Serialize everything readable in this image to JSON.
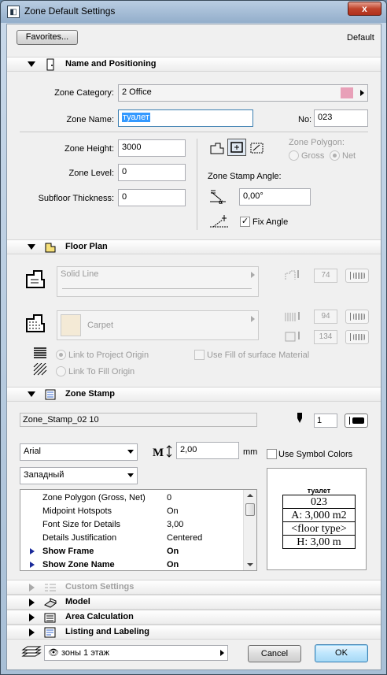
{
  "window": {
    "title": "Zone Default Settings",
    "close_glyph": "x"
  },
  "top": {
    "favorites_label": "Favorites...",
    "default_label": "Default"
  },
  "sections": {
    "name_positioning": "Name and Positioning",
    "floor_plan": "Floor Plan",
    "zone_stamp": "Zone Stamp",
    "custom_settings": "Custom Settings",
    "model": "Model",
    "area_calculation": "Area Calculation",
    "listing_labeling": "Listing and Labeling"
  },
  "name_pos": {
    "zone_category_label": "Zone Category:",
    "zone_category_value": "2  Office",
    "zone_category_color": "#e8a0b8",
    "zone_name_label": "Zone Name:",
    "zone_name_value": "туалет",
    "no_label": "No:",
    "no_value": "023",
    "zone_height_label": "Zone Height:",
    "zone_height_value": "3000",
    "zone_level_label": "Zone Level:",
    "zone_level_value": "0",
    "subfloor_label": "Subfloor Thickness:",
    "subfloor_value": "0",
    "zone_polygon_label": "Zone Polygon:",
    "gross_label": "Gross",
    "net_label": "Net",
    "stamp_angle_label": "Zone Stamp Angle:",
    "stamp_angle_value": "0,00°",
    "fix_angle_label": "Fix Angle",
    "fix_angle_checked": "✓"
  },
  "floor_plan": {
    "line_type": "Solid Line",
    "line_pen": "74",
    "fill_type": "Carpet",
    "fill_pen_fg": "94",
    "fill_pen_bg": "134",
    "link_project_origin": "Link to Project Origin",
    "link_fill_origin": "Link To Fill Origin",
    "use_fill_surface": "Use Fill of surface Material"
  },
  "zone_stamp": {
    "stamp_name": "Zone_Stamp_02 10",
    "pen_value": "1",
    "font_name": "Arial",
    "text_size": "2,00",
    "text_unit": "mm",
    "use_symbol_colors": "Use Symbol Colors",
    "script": "Западный",
    "params": [
      {
        "key": "Zone Polygon (Gross, Net)",
        "value": "0"
      },
      {
        "key": "Midpoint Hotspots",
        "value": "On"
      },
      {
        "key": "Font Size for Details",
        "value": "3,00"
      },
      {
        "key": "Details Justification",
        "value": "Centered"
      },
      {
        "key": "Show Frame",
        "value": "On"
      },
      {
        "key": "Show Zone Name",
        "value": "On"
      }
    ],
    "preview": {
      "name": "туалет",
      "number": "023",
      "area": "A: 3,000 m2",
      "floor_type": "<floor type>",
      "height": "H: 3,00 m"
    }
  },
  "footer": {
    "layer_name": "зоны 1 этаж",
    "cancel_label": "Cancel",
    "ok_label": "OK"
  }
}
